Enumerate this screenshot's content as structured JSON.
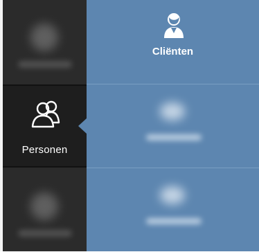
{
  "sidebar": {
    "items": [
      {
        "label": "",
        "icon": "home-icon"
      },
      {
        "label": "Personen",
        "icon": "users-icon"
      },
      {
        "label": "",
        "icon": "square-icon"
      }
    ]
  },
  "main": {
    "tiles": [
      {
        "label": "Cliënten",
        "icon": "client-icon"
      },
      {
        "label": "",
        "icon": "cloud-icon"
      },
      {
        "label": "",
        "icon": "shield-icon"
      }
    ]
  },
  "colors": {
    "sidebar_bg": "#2b2b2b",
    "sidebar_selected_bg": "#1e1e1e",
    "main_bg": "#5d86b0"
  }
}
